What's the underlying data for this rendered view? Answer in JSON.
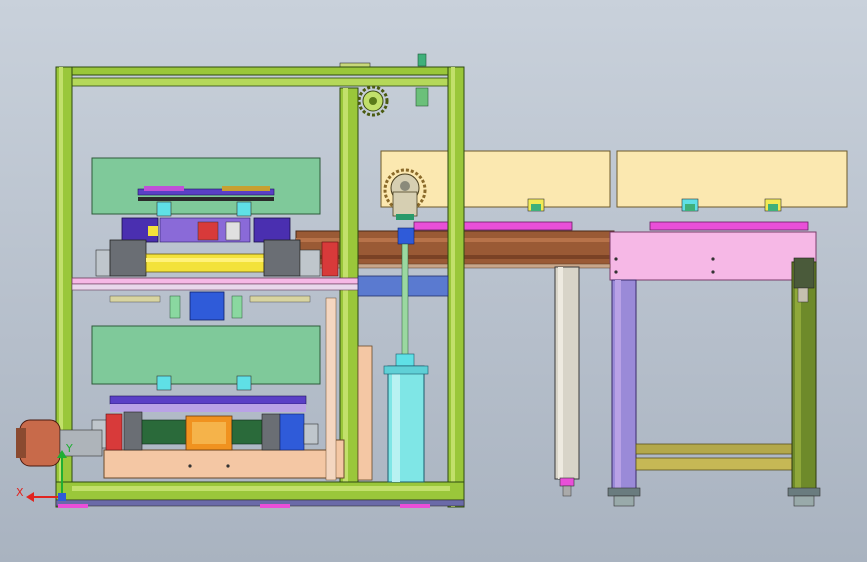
{
  "viewport": {
    "background_top": "#c9d1db",
    "background_bottom": "#a9b3c0"
  },
  "colors": {
    "frame_green": "#9ac73a",
    "frame_green_dark": "#5f8a1a",
    "pale_yellow": "#fbe8b0",
    "green_panel": "#7fc99a",
    "pink": "#f6b8e6",
    "magenta": "#e23fd2",
    "purple": "#5a3fc6",
    "blue": "#2f5bd9",
    "cyan": "#5fe0e6",
    "brown": "#9a5a35",
    "peach": "#f4c7a4",
    "yellow": "#f3e23a",
    "orange": "#f0921f",
    "red": "#d83a3a",
    "gray": "#a3a8ae",
    "lilac": "#b9a2e6",
    "olive": "#7f8a2a"
  },
  "axis_triad": {
    "x_label": "X",
    "y_label": "Y",
    "x_color": "#e0241f",
    "y_color": "#1fae33"
  },
  "icons": [
    "sprocket-icon",
    "axis-triad-icon"
  ]
}
